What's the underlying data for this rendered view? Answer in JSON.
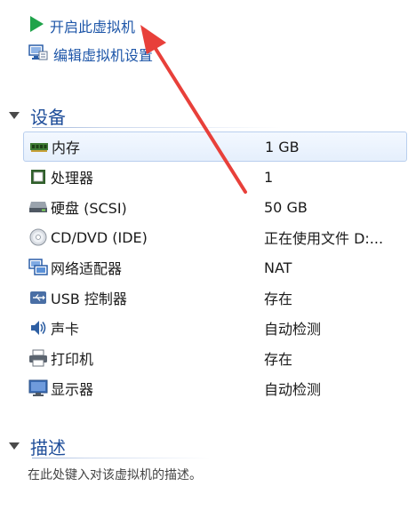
{
  "actions": {
    "start_vm": "开启此虚拟机",
    "edit_vm": "编辑虚拟机设置"
  },
  "sections": {
    "devices_title": "设备",
    "description_title": "描述"
  },
  "devices": [
    {
      "name": "内存",
      "value": "1 GB",
      "icon": "memory-icon"
    },
    {
      "name": "处理器",
      "value": "1",
      "icon": "processor-icon"
    },
    {
      "name": "硬盘 (SCSI)",
      "value": "50 GB",
      "icon": "hard-disk-icon"
    },
    {
      "name": "CD/DVD (IDE)",
      "value": "正在使用文件 D:...",
      "icon": "cd-dvd-icon"
    },
    {
      "name": "网络适配器",
      "value": "NAT",
      "icon": "network-adapter-icon"
    },
    {
      "name": "USB 控制器",
      "value": "存在",
      "icon": "usb-icon"
    },
    {
      "name": "声卡",
      "value": "自动检测",
      "icon": "sound-card-icon"
    },
    {
      "name": "打印机",
      "value": "存在",
      "icon": "printer-icon"
    },
    {
      "name": "显示器",
      "value": "自动检测",
      "icon": "display-icon"
    }
  ],
  "description_placeholder": "在此处键入对该虚拟机的描述。",
  "colors": {
    "link": "#1e56a8",
    "section_title": "#1f4e9a",
    "play_green": "#1fa34a",
    "annotation_arrow": "#e8403a"
  }
}
